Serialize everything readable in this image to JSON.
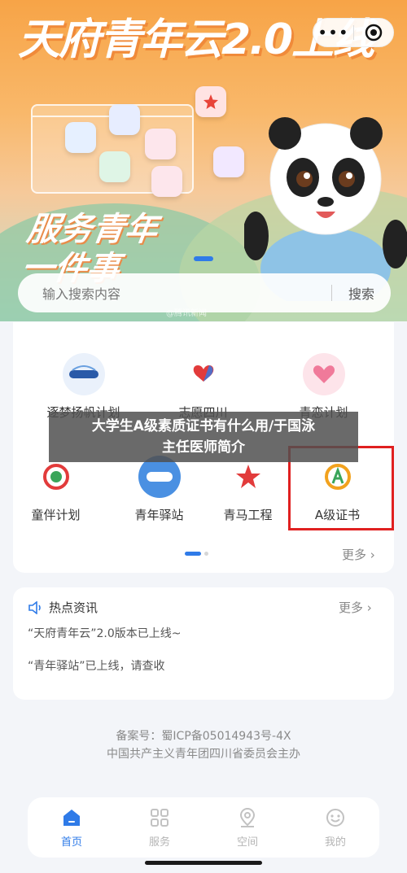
{
  "banner": {
    "title": "天府青年云2.0上线",
    "slogan_line1": "服务青年",
    "slogan_line2": "一件事",
    "watermark": "@腾讯新闻"
  },
  "capsule": {
    "more_icon": "more-dots-icon",
    "close_icon": "target-icon"
  },
  "search": {
    "placeholder": "输入搜索内容",
    "button": "搜索"
  },
  "services": {
    "items": [
      {
        "label": "逐梦扬帆计划",
        "icon": "sail-emblem-icon"
      },
      {
        "label": "志愿四川",
        "icon": "volunteer-heart-icon"
      },
      {
        "label": "青恋计划",
        "icon": "love-heart-icon"
      },
      {
        "label": "童伴计划",
        "icon": "child-companion-icon"
      },
      {
        "label": "青年驿站",
        "icon": "youth-station-icon"
      },
      {
        "label": "青马工程",
        "icon": "star-icon"
      },
      {
        "label": "A级证书",
        "icon": "a-badge-icon"
      }
    ],
    "more": "更多 ›"
  },
  "caption": {
    "line1": "大学生A级素质证书有什么用/于国泳",
    "line2": "主任医师简介"
  },
  "news": {
    "title": "热点资讯",
    "more": "更多 ›",
    "items": [
      "“天府青年云”2.0版本已上线~",
      "“青年驿站”已上线，请查收"
    ]
  },
  "footer": {
    "icp": "备案号：蜀ICP备05014943号-4X",
    "host": "中国共产主义青年团四川省委员会主办"
  },
  "tabs": [
    {
      "label": "首页",
      "icon": "home-icon",
      "active": true
    },
    {
      "label": "服务",
      "icon": "grid-icon",
      "active": false
    },
    {
      "label": "空间",
      "icon": "location-icon",
      "active": false
    },
    {
      "label": "我的",
      "icon": "smile-icon",
      "active": false
    }
  ],
  "colors": {
    "accent": "#2f7be8",
    "highlight_box": "#e02020",
    "banner_orange": "#f7a447"
  }
}
